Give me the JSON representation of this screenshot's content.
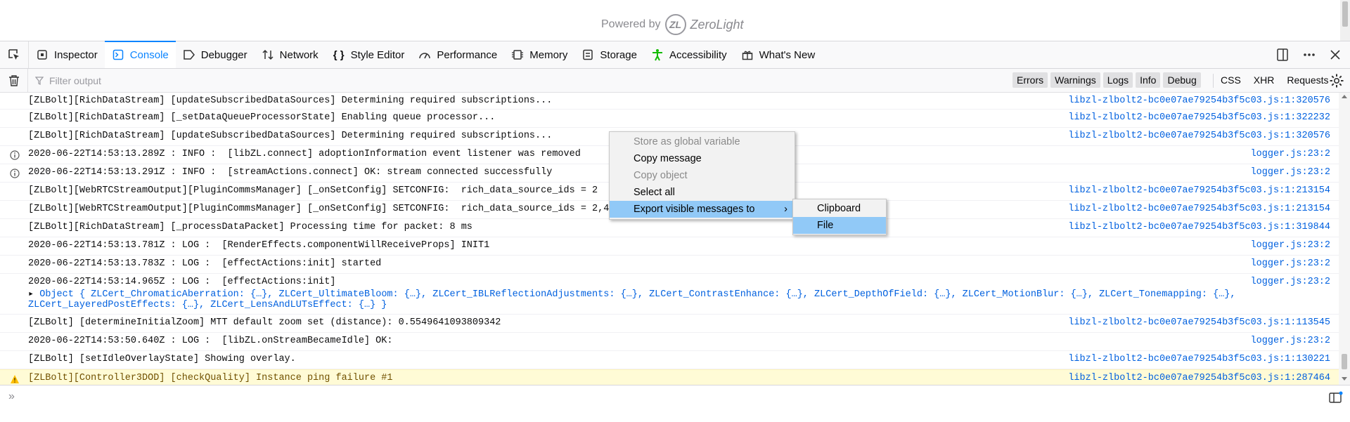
{
  "page": {
    "powered_by": "Powered by",
    "logo_mark": "ZL",
    "brand": "ZeroLight"
  },
  "toolbar": {
    "tabs": [
      {
        "label": "Inspector",
        "icon": "inspector-icon"
      },
      {
        "label": "Console",
        "icon": "console-icon"
      },
      {
        "label": "Debugger",
        "icon": "debugger-icon"
      },
      {
        "label": "Network",
        "icon": "network-icon"
      },
      {
        "label": "Style Editor",
        "icon": "style-editor-icon"
      },
      {
        "label": "Performance",
        "icon": "performance-icon"
      },
      {
        "label": "Memory",
        "icon": "memory-icon"
      },
      {
        "label": "Storage",
        "icon": "storage-icon"
      },
      {
        "label": "Accessibility",
        "icon": "accessibility-icon"
      },
      {
        "label": "What's New",
        "icon": "whats-new-icon"
      }
    ],
    "selected_tab": "Console",
    "accent": "#0a84ff"
  },
  "filter": {
    "placeholder": "Filter output",
    "levels": [
      "Errors",
      "Warnings",
      "Logs",
      "Info",
      "Debug"
    ],
    "net": [
      "CSS",
      "XHR",
      "Requests"
    ]
  },
  "rows": [
    {
      "type": "log",
      "msg": "[ZLBolt][RichDataStream] [updateSubscribedDataSources] Determining required subscriptions...",
      "loc": "libzl-zlbolt2-bc0e07ae79254b3f5c03.js:1:320576"
    },
    {
      "type": "log",
      "msg": "[ZLBolt][RichDataStream] [_setDataQueueProcessorState] Enabling queue processor...",
      "loc": "libzl-zlbolt2-bc0e07ae79254b3f5c03.js:1:322232"
    },
    {
      "type": "log",
      "msg": "[ZLBolt][RichDataStream] [updateSubscribedDataSources] Determining required subscriptions...",
      "loc": "libzl-zlbolt2-bc0e07ae79254b3f5c03.js:1:320576"
    },
    {
      "type": "info",
      "msg": "2020-06-22T14:53:13.289Z : INFO :  [libZL.connect] adoptionInformation event listener was removed",
      "loc": "logger.js:23:2"
    },
    {
      "type": "info",
      "msg": "2020-06-22T14:53:13.291Z : INFO :  [streamActions.connect] OK: stream connected successfully",
      "loc": "logger.js:23:2"
    },
    {
      "type": "log",
      "msg": "[ZLBolt][WebRTCStreamOutput][PluginCommsManager] [_onSetConfig] SETCONFIG:  rich_data_source_ids = 2",
      "loc": "libzl-zlbolt2-bc0e07ae79254b3f5c03.js:1:213154"
    },
    {
      "type": "log",
      "msg": "[ZLBolt][WebRTCStreamOutput][PluginCommsManager] [_onSetConfig] SETCONFIG:  rich_data_source_ids = 2,4",
      "loc": "libzl-zlbolt2-bc0e07ae79254b3f5c03.js:1:213154"
    },
    {
      "type": "log",
      "msg": "[ZLBolt][RichDataStream] [_processDataPacket] Processing time for packet: 8 ms",
      "loc": "libzl-zlbolt2-bc0e07ae79254b3f5c03.js:1:319844"
    },
    {
      "type": "log",
      "msg": "2020-06-22T14:53:13.781Z : LOG :  [RenderEffects.componentWillReceiveProps] INIT1",
      "loc": "logger.js:23:2"
    },
    {
      "type": "log",
      "msg": "2020-06-22T14:53:13.783Z : LOG :  [effectActions:init] started",
      "loc": "logger.js:23:2"
    },
    {
      "type": "log",
      "msg": "2020-06-22T14:53:14.965Z : LOG :  [effectActions:init]",
      "loc": "logger.js:23:2"
    },
    {
      "type": "log",
      "msg": "[ZLBolt] [determineInitialZoom] MTT default zoom set (distance): 0.5549641093809342",
      "loc": "libzl-zlbolt2-bc0e07ae79254b3f5c03.js:1:113545"
    },
    {
      "type": "log",
      "msg": "2020-06-22T14:53:50.640Z : LOG :  [libZL.onStreamBecameIdle] OK:",
      "loc": "logger.js:23:2"
    },
    {
      "type": "log",
      "msg": "[ZLBolt] [setIdleOverlayState] Showing overlay.",
      "loc": "libzl-zlbolt2-bc0e07ae79254b3f5c03.js:1:130221"
    },
    {
      "type": "warn",
      "msg": "[ZLBolt][Controller3DOD] [checkQuality] Instance ping failure #1",
      "loc": "libzl-zlbolt2-bc0e07ae79254b3f5c03.js:1:287464"
    }
  ],
  "object_preview": {
    "line1": "Object { ZLCert_ChromaticAberration: {…}, ZLCert_UltimateBloom: {…}, ZLCert_IBLReflectionAdjustments: {…}, ZLCert_ContrastEnhance: {…}, ZLCert_DepthOfField: {…}, ZLCert_MotionBlur: {…}, ZLCert_Tonemapping: {…},",
    "line2": "ZLCert_LayeredPostEffects: {…}, ZLCert_LensAndLUTsEffect: {…} }"
  },
  "context_menu": {
    "items": [
      {
        "label": "Store as global variable",
        "disabled": true
      },
      {
        "label": "Copy message",
        "disabled": false
      },
      {
        "label": "Copy object",
        "disabled": true
      },
      {
        "label": "Select all",
        "disabled": false
      },
      {
        "label": "Export visible messages to",
        "disabled": false,
        "submenu": true,
        "highlighted": true
      }
    ],
    "submenu_arrow": "›"
  },
  "submenu": {
    "items": [
      {
        "label": "Clipboard",
        "highlighted": false
      },
      {
        "label": "File",
        "highlighted": true
      }
    ]
  },
  "console_input": {
    "prompt": "»"
  }
}
